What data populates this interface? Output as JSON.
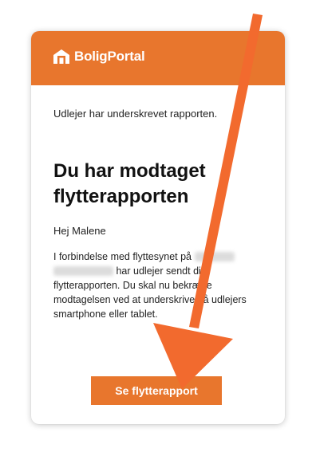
{
  "header": {
    "brand_name": "BoligPortal",
    "brand_icon": "house-icon",
    "accent_color": "#e8762d"
  },
  "email": {
    "status_text": "Udlejer har underskrevet rapporten.",
    "title": "Du har modtaget flytterapporten",
    "greeting": "Hej Malene",
    "body_lines": [
      "I forbindelse med flyttesynet på",
      "har udlejer sendt dig",
      "flytterapporten. Du skal nu bekræfte",
      "modtagelsen ved at underskrive på udlejers",
      "smartphone eller tablet."
    ],
    "cta_label": "Se flytterapport"
  },
  "annotation": {
    "arrow_color": "#f26a2e"
  }
}
